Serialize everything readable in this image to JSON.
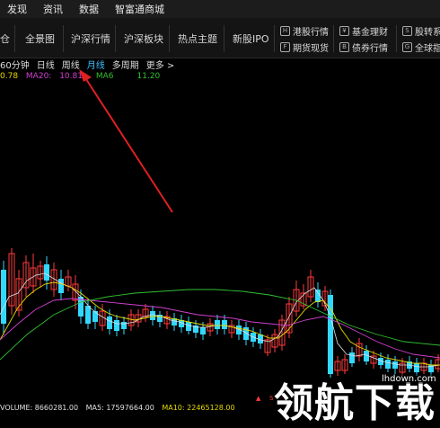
{
  "menu": [
    "发现",
    "资讯",
    "数据",
    "智富通商城"
  ],
  "toolbar": {
    "items": [
      "仓",
      "全景图",
      "沪深行情",
      "沪深板块",
      "热点主题",
      "新股IPO"
    ],
    "small_left": [
      {
        "label": "港股行情",
        "icon": "hk-icon"
      },
      {
        "label": "期货现货",
        "icon": "futures-icon"
      }
    ],
    "small_mid": [
      {
        "label": "基金理财",
        "icon": "fund-icon"
      },
      {
        "label": "债券行情",
        "icon": "bond-icon"
      }
    ],
    "small_right": [
      {
        "label": "股转系",
        "icon": "transfer-icon"
      },
      {
        "label": "全球指",
        "icon": "globe-icon"
      }
    ]
  },
  "periods": {
    "items": [
      "60分钟",
      "日线",
      "周线",
      "月线",
      "多周期",
      "更多 >"
    ],
    "active": "月线"
  },
  "ma_legend": {
    "ma10": "0.78",
    "ma20_label": "MA20:",
    "ma20": "10.81",
    "ma60_label": "MA6",
    "ma60": "11.20"
  },
  "volume_legend": {
    "volume": "VOLUME: 8660281.00",
    "ma5": "MA5: 17597664.00",
    "ma10": "MA10: 22465128.00"
  },
  "watermark": {
    "text": "领航下载",
    "url": "lhdown.com"
  },
  "colors": {
    "up": "#ff3b3b",
    "down": "#33d8ff",
    "ma5": "#e0e0e0",
    "ma10": "#e6d800",
    "ma20": "#d040d0",
    "ma60": "#30c030",
    "active_period": "#3fc0ff"
  },
  "chart_data": {
    "type": "candlestick",
    "series": [
      {
        "name": "MA5",
        "values": []
      },
      {
        "name": "MA10",
        "values": []
      },
      {
        "name": "MA20",
        "values": [
          10.81
        ]
      },
      {
        "name": "MA60",
        "values": [
          11.2
        ]
      }
    ]
  }
}
